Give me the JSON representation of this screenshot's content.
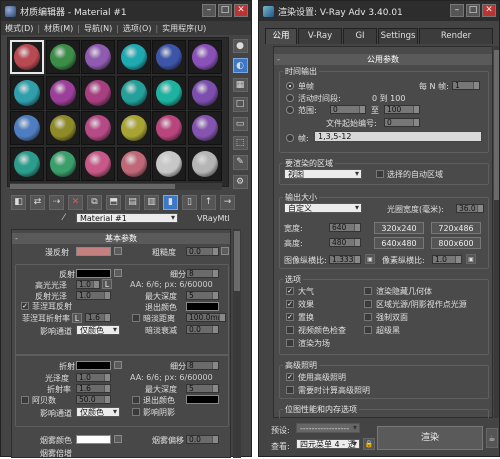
{
  "mat_editor": {
    "title": "材质编辑器 - Material #1",
    "menu": [
      "模式(D)",
      "材质(M)",
      "导航(N)",
      "选项(O)",
      "实用程序(U)"
    ],
    "sample_colors": [
      "#b84a52",
      "#3c8d48",
      "#8f5bb0",
      "#1eaab0",
      "#3c55a8",
      "#8a52b8",
      "#2f9fab",
      "#9c3f9a",
      "#a73f80",
      "#23a099",
      "#1eb2a0",
      "#7c4eae",
      "#4f7ec0",
      "#8f8a28",
      "#b54a86",
      "#a8a434",
      "#b8457c",
      "#8554b0",
      "#2c9d8c",
      "#3a9f6a",
      "#c85888",
      "#c06878",
      "#c7c7c7",
      "#b5b5b5"
    ],
    "material_name": "Material #1",
    "material_type": "VRayMtl",
    "basic_rollout": "基本参数",
    "diffuse_label": "漫反射",
    "diffuse_color": "#c4807e",
    "roughness_label": "粗糙度",
    "roughness_value": "0.0",
    "reflect": {
      "label": "反射",
      "subdivs_label": "细分",
      "subdivs": "8",
      "hilight_label": "高光光泽",
      "hilight": "1.0",
      "hilight_btn": "L",
      "aa_text": "AA: 6/6; px: 6/60000",
      "gloss_label": "反射光泽",
      "gloss": "1.0",
      "maxdepth_label": "最大深度",
      "maxdepth": "5",
      "fresnel_label": "菲涅耳反射",
      "fresnel_checked": true,
      "exit_label": "退出颜色",
      "fresnel_ior_label": "菲涅耳折射率",
      "fresnel_ior": "1.6",
      "fresnel_btn": "L",
      "dim_label": "暗淡距离",
      "dim_value": "100.0mm",
      "affect_label": "影响通道",
      "affect_value": "仅颜色",
      "dim_falloff_label": "暗淡衰减",
      "dim_falloff": "0.0"
    },
    "refract": {
      "label": "折射",
      "subdivs_label": "细分",
      "subdivs": "8",
      "gloss_label": "光泽度",
      "gloss": "1.0",
      "aa_text": "AA: 6/6; px: 6/60000",
      "ior_label": "折射率",
      "ior": "1.6",
      "maxdepth_label": "最大深度",
      "maxdepth": "5",
      "abbe_label": "阿贝数",
      "abbe": "50.0",
      "exit_label": "退出颜色",
      "affect_label": "影响通道",
      "affect_value": "仅颜色",
      "shadow_label": "影响阴影"
    },
    "fog": {
      "color_label": "烟雾颜色",
      "bias_label": "烟雾偏移",
      "bias": "0.0",
      "mult_label": "烟雾倍增"
    }
  },
  "render_setup": {
    "title": "渲染设置: V-Ray Adv 3.40.01",
    "tabs": [
      "公用",
      "V-Ray",
      "GI",
      "Settings",
      "Render Elements"
    ],
    "common_rollout": "公用参数",
    "time_output": {
      "title": "时间输出",
      "single": "单帧",
      "every_n_label": "每 N 帧:",
      "every_n": "1",
      "active_segment": "活动时间段:",
      "active_range": "0 到 100",
      "range_label": "范围:",
      "range_from": "0",
      "range_to_label": "至",
      "range_to": "100",
      "file_start_label": "文件起始编号:",
      "file_start": "0",
      "frames_label": "帧:",
      "frames": "1,3,5-12"
    },
    "area": {
      "title": "要渲染的区域",
      "value": "视图",
      "auto_region": "选择的自动区域"
    },
    "output_size": {
      "title": "输出大小",
      "preset": "自定义",
      "aperture_label": "光圈宽度(毫米):",
      "aperture": "36.0",
      "width_label": "宽度:",
      "width": "640",
      "height_label": "高度:",
      "height": "480",
      "presets": [
        "320x240",
        "720x486",
        "640x480",
        "800x600"
      ],
      "img_aspect_label": "图像纵横比:",
      "img_aspect": "1.333",
      "pix_aspect_label": "像素纵横比:",
      "pix_aspect": "1.0"
    },
    "options": {
      "title": "选项",
      "items": [
        {
          "label": "大气",
          "checked": true
        },
        {
          "label": "渲染隐藏几何体",
          "checked": false
        },
        {
          "label": "效果",
          "checked": true
        },
        {
          "label": "区域光源/阴影视作点光源",
          "checked": false
        },
        {
          "label": "置换",
          "checked": true
        },
        {
          "label": "强制双面",
          "checked": false
        },
        {
          "label": "视频颜色检查",
          "checked": false
        },
        {
          "label": "超级黑",
          "checked": false
        },
        {
          "label": "渲染为场",
          "checked": false
        }
      ]
    },
    "advanced_lighting": {
      "title": "高级照明",
      "use": "使用高级照明",
      "compute": "需要时计算高级照明"
    },
    "bitmap_title": "位图性能和内存选项",
    "preset_label": "预设:",
    "preset_value": "-----------------",
    "view_label": "查看:",
    "view_value": "四元菜单 4 - 透",
    "render_button": "渲染"
  }
}
